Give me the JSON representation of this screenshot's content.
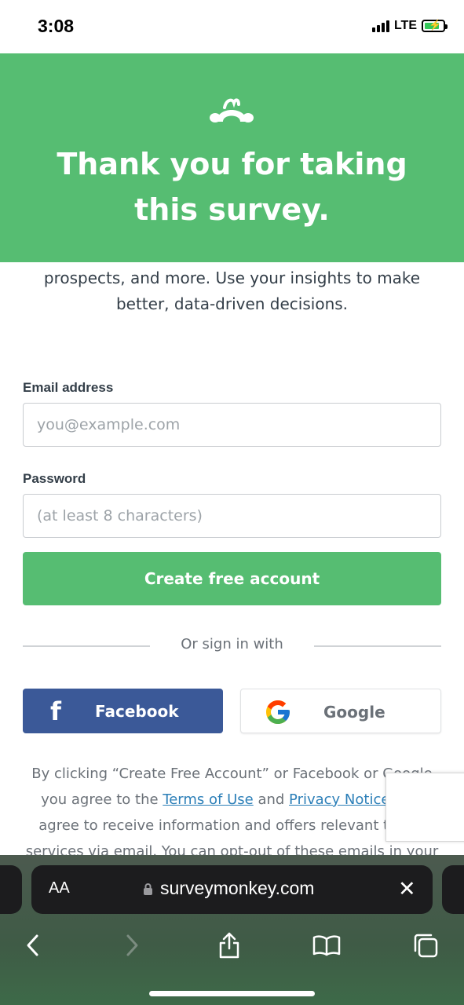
{
  "status_bar": {
    "time": "3:08",
    "network": "LTE"
  },
  "hero": {
    "title": "Thank you for taking this survey."
  },
  "intro": {
    "text": "prospects, and more. Use your insights to make better, data-driven decisions."
  },
  "form": {
    "email_label": "Email address",
    "email_placeholder": "you@example.com",
    "email_value": "",
    "password_label": "Password",
    "password_placeholder": "(at least 8 characters)",
    "password_value": "",
    "create_button": "Create free account"
  },
  "signin": {
    "divider_text": "Or sign in with",
    "facebook_label": "Facebook",
    "google_label": "Google"
  },
  "legal": {
    "part1": "By clicking “Create Free Account” or Facebook or Google you agree to the ",
    "terms_link": "Terms of Use",
    "part2": " and ",
    "privacy_link": "Privacy Notice",
    "part3": ". You agree to receive information and offers relevant to our services via email. You can opt-out of these emails in your"
  },
  "browser": {
    "text_size_label": "AA",
    "url": "surveymonkey.com"
  },
  "colors": {
    "brand_green": "#56bd72",
    "facebook_blue": "#3b5998",
    "link_blue": "#2c7fb8"
  },
  "icons": [
    "surveymonkey-logo-icon",
    "signal-icon",
    "battery-icon",
    "facebook-icon",
    "google-icon",
    "lock-icon",
    "close-icon",
    "back-icon",
    "forward-icon",
    "share-icon",
    "bookmarks-icon",
    "tabs-icon"
  ]
}
